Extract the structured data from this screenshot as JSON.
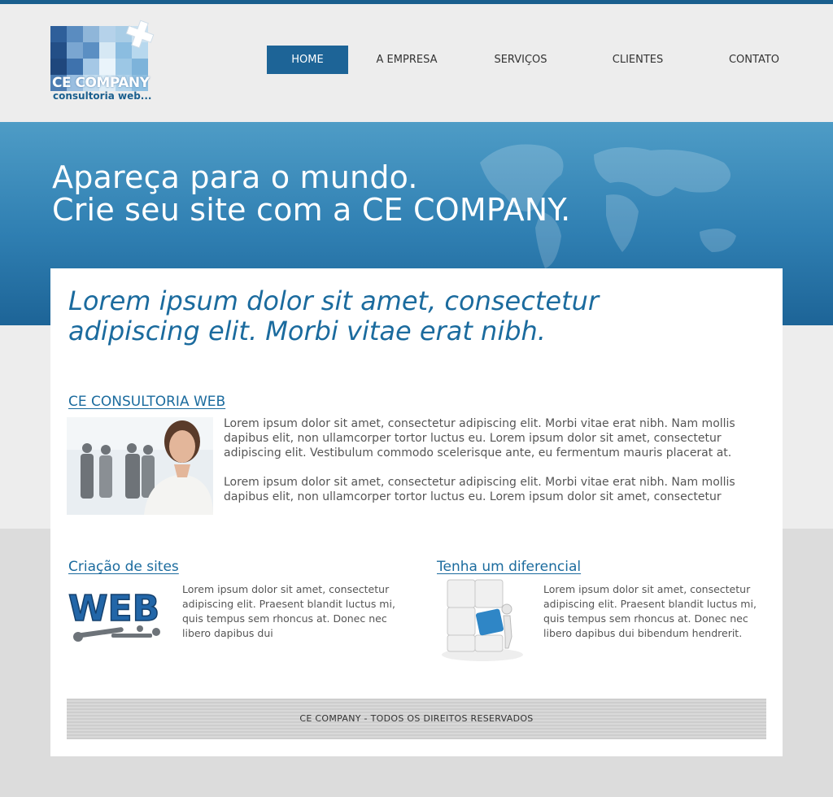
{
  "brand": {
    "name": "CE COMPANY",
    "tagline": "consultoria web..."
  },
  "nav": {
    "items": [
      {
        "label": "HOME",
        "active": true
      },
      {
        "label": "A EMPRESA"
      },
      {
        "label": "SERVIÇOS"
      },
      {
        "label": "CLIENTES"
      },
      {
        "label": "CONTATO"
      }
    ]
  },
  "hero": {
    "title": "Apareça para o mundo.\nCrie seu site com a CE COMPANY."
  },
  "main": {
    "lead": "Lorem ipsum dolor sit amet, consectetur\nadipiscing elit. Morbi vitae erat nibh.",
    "section1": {
      "title": "CE CONSULTORIA WEB",
      "p1": "Lorem ipsum dolor sit amet, consectetur adipiscing elit. Morbi vitae erat nibh. Nam mollis dapibus elit, non ullamcorper tortor luctus eu. Lorem ipsum dolor sit amet, consectetur adipiscing elit. Vestibulum commodo scelerisque ante, eu fermentum mauris placerat at.",
      "p2": "Lorem ipsum dolor sit amet, consectetur adipiscing elit. Morbi vitae erat nibh. Nam mollis dapibus elit, non ullamcorper tortor luctus eu. Lorem ipsum dolor sit amet, consectetur"
    },
    "section2": {
      "title": "Criação de sites",
      "image_text": "WEB",
      "text": "Lorem ipsum dolor sit amet, consectetur adipiscing elit. Praesent blandit luctus mi, quis tempus sem rhoncus at. Donec nec libero dapibus dui"
    },
    "section3": {
      "title": "Tenha um diferencial",
      "text": "Lorem ipsum dolor sit amet, consectetur adipiscing elit. Praesent blandit luctus mi, quis tempus sem rhoncus at. Donec nec libero dapibus dui bibendum hendrerit."
    }
  },
  "footer": {
    "text": "CE COMPANY - TODOS OS DIREITOS RESERVADOS"
  },
  "colors": {
    "primary": "#1d6497",
    "accent": "#1b6b9e",
    "hero_light": "#4e9cc6"
  }
}
